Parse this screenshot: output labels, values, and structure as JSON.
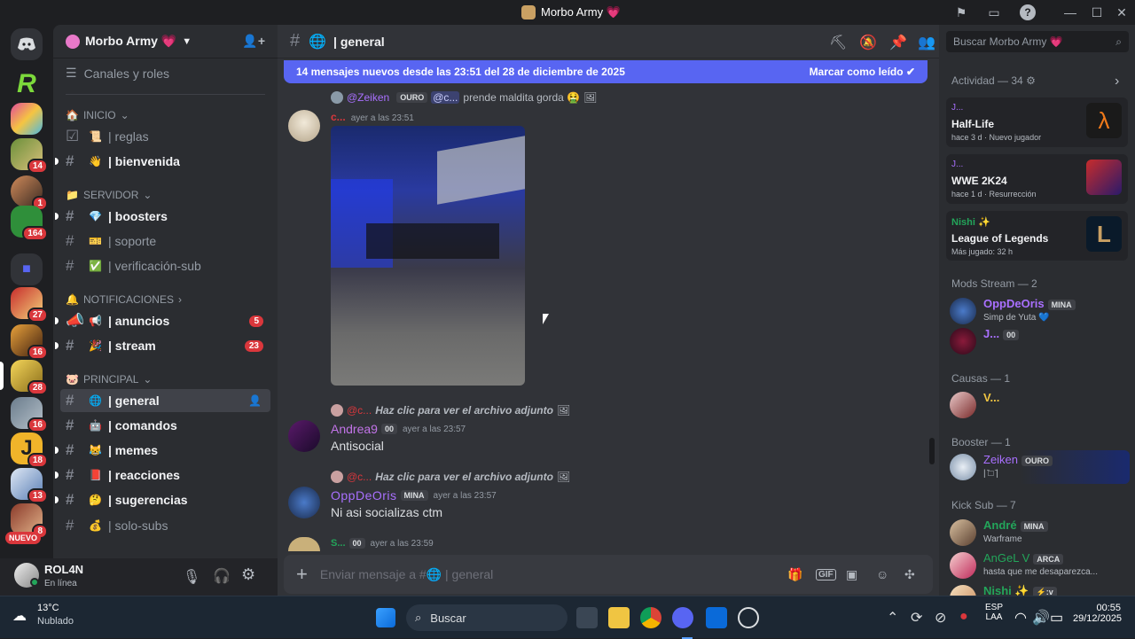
{
  "window": {
    "title": "Morbo Army 💗"
  },
  "rail": {
    "badges": [
      "14",
      "1",
      "164",
      "27",
      "16",
      "28",
      "16",
      "18",
      "13",
      "8"
    ],
    "new_label": "NUEVO"
  },
  "sidebar": {
    "server_name": "Morbo Army 💗",
    "channels_roles": "Canales y roles",
    "cat_inicio": "INICIO",
    "cat_servidor": "SERVIDOR",
    "cat_notif": "NOTIFICACIONES",
    "cat_principal": "PRINCIPAL",
    "channels": [
      {
        "icon": "📜",
        "name": "| reglas"
      },
      {
        "icon": "👋",
        "name": "| bienvenida"
      },
      {
        "icon": "💎",
        "name": "| boosters"
      },
      {
        "icon": "🎫",
        "name": "| soporte"
      },
      {
        "icon": "✅",
        "name": "| verificación-sub"
      },
      {
        "icon": "📢",
        "name": "| anuncios",
        "count": "5"
      },
      {
        "icon": "🎉",
        "name": "| stream",
        "count": "23"
      },
      {
        "icon": "🌐",
        "name": "| general"
      },
      {
        "icon": "🤖",
        "name": "| comandos"
      },
      {
        "icon": "😹",
        "name": "| memes"
      },
      {
        "icon": "📕",
        "name": "| reacciones"
      },
      {
        "icon": "🤔",
        "name": "| sugerencias"
      },
      {
        "icon": "💰",
        "name": "| solo-subs"
      }
    ]
  },
  "user": {
    "name": "ROL4N",
    "status": "En línea"
  },
  "channel": {
    "name": "| general",
    "search_placeholder": "Buscar Morbo Army 💗",
    "new_messages": "14 mensajes nuevos desde las 23:51 del 28 de diciembre de 2025",
    "mark_read": "Marcar como leído",
    "composer_placeholder": "Enviar mensaje a #🌐 | general"
  },
  "messages": [
    {
      "reply_user": "@Zeiken",
      "reply_tag": "OURO",
      "reply_mention": "@c...",
      "reply_text": "prende maldita gorda 🤮",
      "author": "c...",
      "time": "ayer a las 23:51"
    },
    {
      "reply_user": "@c...",
      "reply_text": "Haz clic para ver el archivo adjunto",
      "author": "Andrea9",
      "tag": "00",
      "time": "ayer a las 23:57",
      "text": "Antisocial"
    },
    {
      "reply_user": "@c...",
      "reply_text": "Haz clic para ver el archivo adjunto",
      "author": "OppDeOris",
      "tag": "MINA",
      "time": "ayer a las 23:57",
      "text": "Ni asi socializas ctm"
    },
    {
      "author": "S...",
      "tag": "00",
      "time": "ayer a las 23:59"
    }
  ],
  "members": {
    "activity_head": "Actividad — 34",
    "activities": [
      {
        "user": "J...",
        "game": "Half-Life",
        "meta": "hace 3 d",
        "extra": "Nuevo jugador"
      },
      {
        "user": "J...",
        "game": "WWE 2K24",
        "meta": "hace 1 d",
        "extra": "Resurrección"
      },
      {
        "user": "Nishi ✨",
        "game": "League of Legends",
        "meta": "Más jugado: 32 h"
      }
    ],
    "mods_head": "Mods Stream — 2",
    "mods": [
      {
        "name": "OppDeOris",
        "tag": "MINA",
        "status": "Simp de Yuta 💙"
      },
      {
        "name": "J...",
        "tag": "00"
      }
    ],
    "causas_head": "Causas — 1",
    "causas": [
      {
        "name": "V..."
      }
    ],
    "booster_head": "Booster — 1",
    "booster": [
      {
        "name": "Zeiken",
        "tag": "OURO",
        "status": "| ̄□ ̄|"
      }
    ],
    "kick_head": "Kick Sub — 7",
    "kick": [
      {
        "name": "André",
        "tag": "MINA",
        "status": "Warframe"
      },
      {
        "name": "AnGeL V",
        "tag": "ARCA",
        "status": "hasta que me desaparezca..."
      },
      {
        "name": "Nishi ✨",
        "tag": "⚡:v"
      }
    ]
  },
  "taskbar": {
    "weather_temp": "13°C",
    "weather_desc": "Nublado",
    "search": "Buscar",
    "lang1": "ESP",
    "lang2": "LAA",
    "time": "00:55",
    "date": "29/12/2025"
  },
  "colors": {
    "blurple": "#5865f2",
    "red": "#da373c",
    "green": "#23a55a",
    "purple": "#a970ff"
  }
}
